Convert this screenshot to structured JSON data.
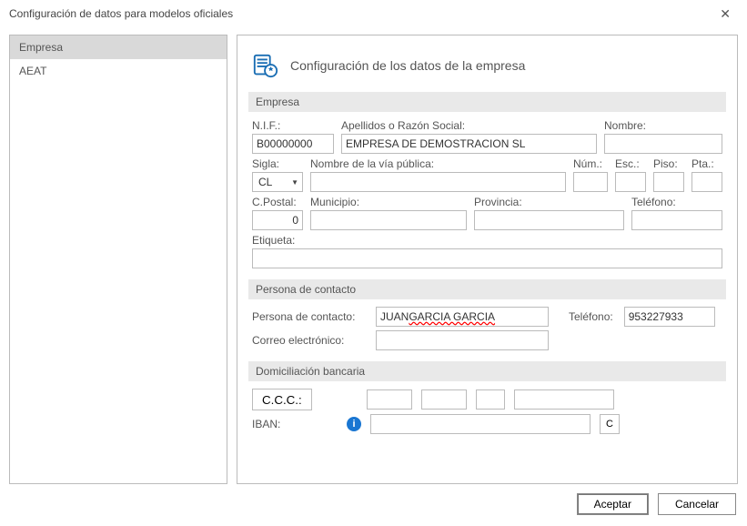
{
  "window": {
    "title": "Configuración de datos para modelos oficiales"
  },
  "sidebar": {
    "items": [
      {
        "label": "Empresa"
      },
      {
        "label": "AEAT"
      }
    ]
  },
  "header": {
    "title": "Configuración de los datos de la empresa"
  },
  "sections": {
    "empresa": "Empresa",
    "contacto": "Persona de contacto",
    "bancaria": "Domiciliación bancaria"
  },
  "labels": {
    "nif": "N.I.F.:",
    "apellidos": "Apellidos o Razón Social:",
    "nombre": "Nombre:",
    "sigla": "Sigla:",
    "via": "Nombre de la vía pública:",
    "num": "Núm.:",
    "esc": "Esc.:",
    "piso": "Piso:",
    "pta": "Pta.:",
    "cpostal": "C.Postal:",
    "municipio": "Municipio:",
    "provincia": "Provincia:",
    "telefono": "Teléfono:",
    "etiqueta": "Etiqueta:",
    "persona_contacto": "Persona de contacto:",
    "telefono_contacto": "Teléfono:",
    "correo": "Correo electrónico:",
    "ccc": "C.C.C.:",
    "iban": "IBAN:"
  },
  "empresa": {
    "nif": "B00000000",
    "apellidos": "EMPRESA DE DEMOSTRACION SL",
    "nombre": "",
    "sigla": "CL",
    "via": "",
    "num": "",
    "esc": "",
    "piso": "",
    "pta": "",
    "cpostal": "0",
    "municipio": "",
    "provincia": "",
    "telefono": "",
    "etiqueta": ""
  },
  "contacto": {
    "persona_pre": "JUAN ",
    "persona_wavy": "GARCIA GARCIA",
    "telefono": "953227933",
    "correo": ""
  },
  "bancaria": {
    "ccc1": "",
    "ccc2": "",
    "ccc3": "",
    "ccc4": "",
    "iban": "",
    "calcbtn": "C"
  },
  "buttons": {
    "aceptar": "Aceptar",
    "cancelar": "Cancelar"
  }
}
